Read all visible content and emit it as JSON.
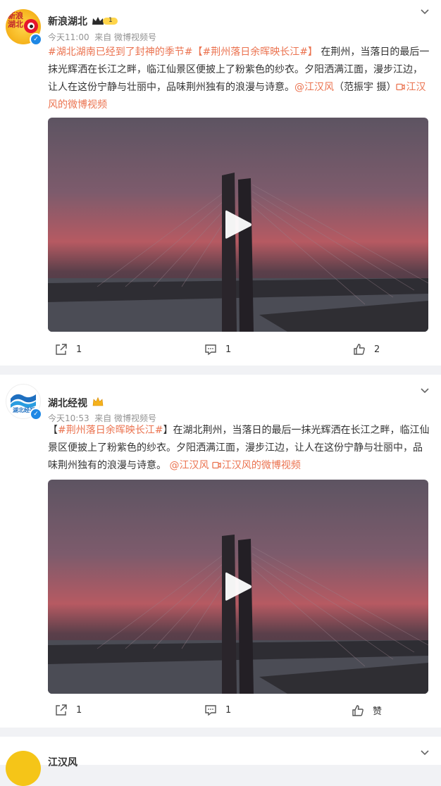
{
  "posts": [
    {
      "author": "新浪湖北",
      "avatar_text": "新浪湖北",
      "level_badge": "1",
      "time": "今天11:00",
      "source": "来自 微博视频号",
      "text": {
        "tag1": "#湖北湖南已经到了封神的季节#",
        "tag2": "【#荆州落日余晖映长江#】",
        "body": "在荆州，当落日的最后一抹光辉洒在长江之畔，临江仙景区便披上了粉紫色的纱衣。夕阳洒满江面，漫步江边，让人在这份宁静与壮丽中，品味荆州独有的浪漫与诗意。",
        "mention": "@江汉风",
        "credit": "（范振宇 摄）",
        "video_link": "江汉风的微博视频"
      },
      "actions": {
        "share": "1",
        "comment": "1",
        "like": "2"
      }
    },
    {
      "author": "湖北经视",
      "avatar_text": "湖北经视",
      "time": "今天10:53",
      "source": "来自 微博视频号",
      "text": {
        "bracket_open": "【",
        "tag": "#荆州落日余晖映长江#",
        "bracket_close": "】",
        "body": "在湖北荆州，当落日的最后一抹光辉洒在长江之畔，临江仙景区便披上了粉紫色的纱衣。夕阳洒满江面，漫步江边，让人在这份宁静与壮丽中，品味荆州独有的浪漫与诗意。",
        "mention": "@江汉风",
        "video_link": "江汉风的微博视频"
      },
      "actions": {
        "share": "1",
        "comment": "1",
        "like": "赞"
      }
    },
    {
      "author": "江汉风"
    }
  ],
  "colors": {
    "link": "#eb7350",
    "meta": "#939393",
    "background": "#f1f2f5",
    "verified": "#1e88e5"
  },
  "icons": [
    "chevron-down-icon",
    "play-icon",
    "share-icon",
    "comment-icon",
    "like-icon",
    "verified-icon",
    "crown-icon",
    "video-link-icon"
  ]
}
